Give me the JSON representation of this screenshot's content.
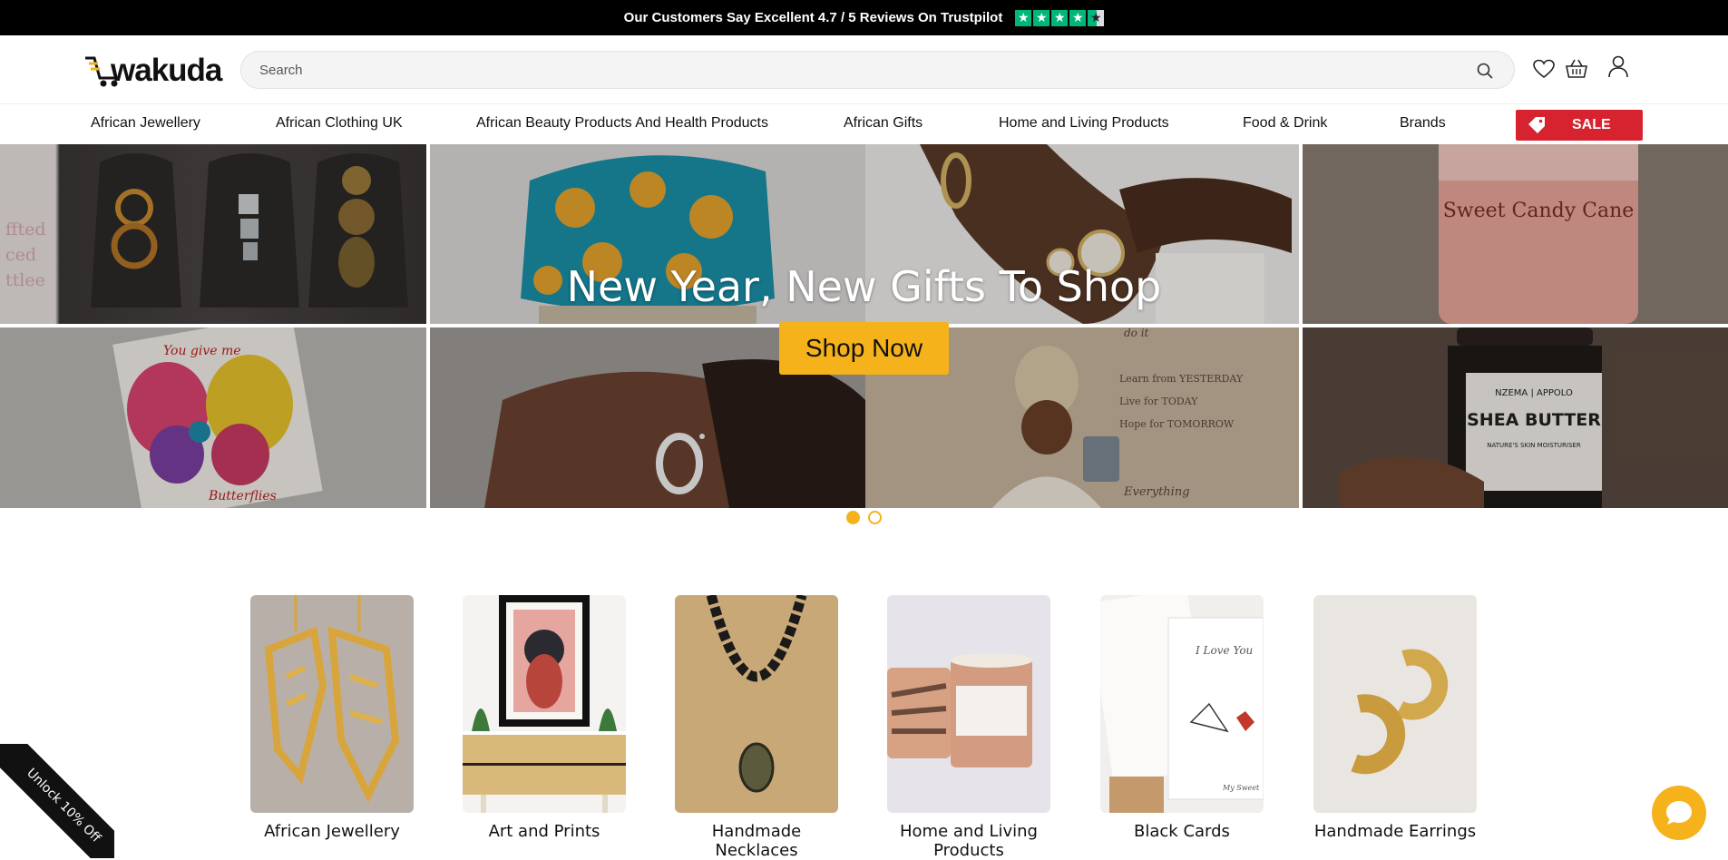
{
  "topbar": {
    "text": "Our Customers Say Excellent 4.7 / 5 Reviews On Trustpilot",
    "stars": 4.5,
    "star_color": "#00b67a"
  },
  "header": {
    "logo_text": "wakuda",
    "search_placeholder": "Search",
    "icons": [
      "search-icon",
      "heart-icon",
      "basket-icon",
      "user-icon"
    ]
  },
  "nav": {
    "items": [
      "African Jewellery",
      "African Clothing UK",
      "African Beauty Products And Health Products",
      "African Gifts",
      "Home and Living Products",
      "Food & Drink",
      "Brands"
    ],
    "sale_label": "SALE",
    "sale_color": "#d7232f"
  },
  "hero": {
    "title": "New Year, New Gifts To Shop",
    "button": "Shop Now",
    "accent": "#f6b21b",
    "slides": 2,
    "active_slide": 1,
    "tile_texts": {
      "card": "You give me",
      "card_bottom": "Butterflies",
      "candle_brand": "Sweet Candy Cane",
      "jar_brand": "NZEMA | APPOLO",
      "jar_title": "SHEA BUTTER",
      "jar_sub": "NATURE'S SKIN MOISTURISER",
      "print_1": "Learn from YESTERDAY",
      "print_2": "Live for TODAY",
      "print_3": "Hope for TOMORROW",
      "print_4": "Everything",
      "print_top": "do it"
    }
  },
  "categories": [
    {
      "label": "African Jewellery"
    },
    {
      "label": "Art and Prints"
    },
    {
      "label": "Handmade Necklaces"
    },
    {
      "label": "Home and Living Products"
    },
    {
      "label": "Black Cards"
    },
    {
      "label": "Handmade Earrings"
    }
  ],
  "category_card_text": {
    "card": "I Love You",
    "card_sign": "My Sweet"
  },
  "ribbon": {
    "text": "Unlock 10% Off"
  }
}
